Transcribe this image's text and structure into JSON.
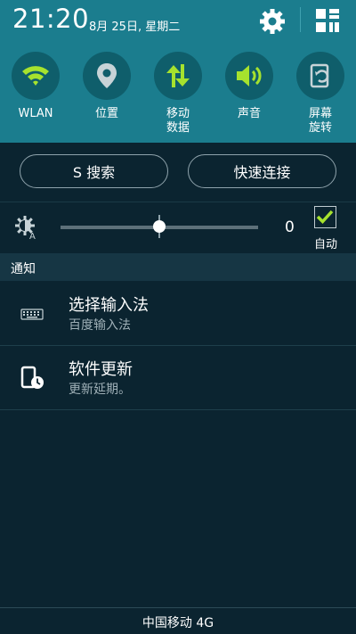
{
  "status": {
    "time": "21:20",
    "date": "8月 25日, 星期二"
  },
  "quick_toggles": [
    {
      "label": "WLAN",
      "icon": "wifi-icon",
      "active": true
    },
    {
      "label": "位置",
      "icon": "location-icon",
      "active": false
    },
    {
      "label": "移动\n数据",
      "icon": "mobile-data-icon",
      "active": true
    },
    {
      "label": "声音",
      "icon": "sound-icon",
      "active": true
    },
    {
      "label": "屏幕\n旋转",
      "icon": "screen-rotation-icon",
      "active": false
    }
  ],
  "buttons": {
    "search": "S 搜索",
    "quick_connect": "快速连接"
  },
  "brightness": {
    "value": "0",
    "auto_label": "自动",
    "auto_checked": true,
    "level": 0.5
  },
  "notifications": {
    "header": "通知",
    "items": [
      {
        "title": "选择输入法",
        "subtitle": "百度输入法",
        "icon": "keyboard-icon"
      },
      {
        "title": "软件更新",
        "subtitle": "更新延期。",
        "icon": "software-update-icon"
      }
    ]
  },
  "carrier": "中国移动 4G",
  "colors": {
    "accent": "#a6e22e",
    "panel": "#1b7d8e",
    "background": "#0b2430"
  }
}
